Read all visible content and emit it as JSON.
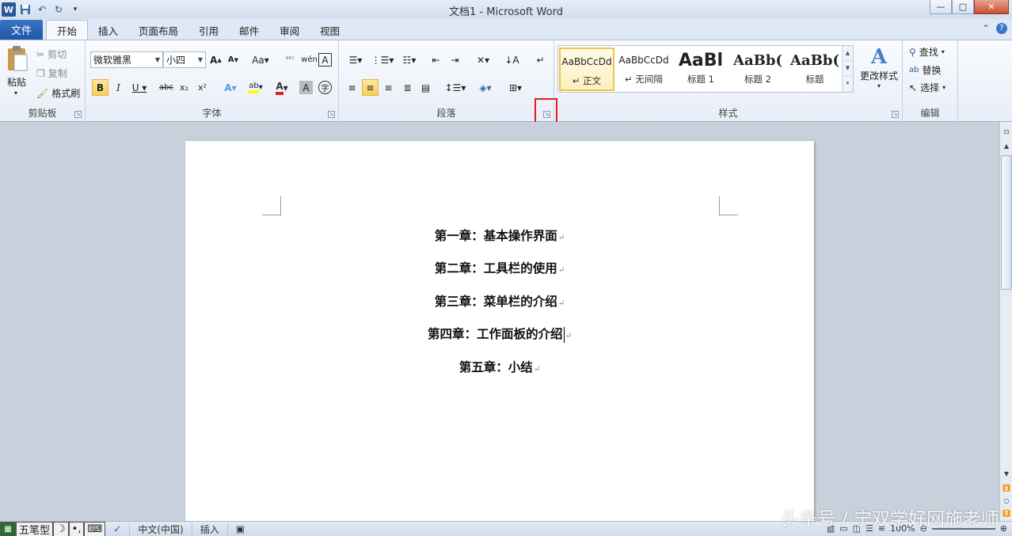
{
  "window": {
    "title": "文档1 - Microsoft Word",
    "minimize": "—",
    "maximize": "□",
    "close": "✕"
  },
  "qat": {
    "word_icon": "W",
    "save_icon": "save-icon",
    "undo_icon": "undo-icon",
    "redo_icon": "redo-icon"
  },
  "tabs": {
    "file": "文件",
    "items": [
      "开始",
      "插入",
      "页面布局",
      "引用",
      "邮件",
      "审阅",
      "视图"
    ]
  },
  "clipboard": {
    "paste": "粘贴",
    "cut": "剪切",
    "copy": "复制",
    "format_painter": "格式刷",
    "label": "剪贴板"
  },
  "font": {
    "family": "微软雅黑",
    "size": "小四",
    "label": "字体"
  },
  "paragraph": {
    "label": "段落"
  },
  "styles": {
    "items": [
      {
        "sample": "AaBbCcDd",
        "name": "↵ 正文"
      },
      {
        "sample": "AaBbCcDd",
        "name": "↵ 无间隔"
      },
      {
        "sample": "AaBl",
        "name": "标题 1"
      },
      {
        "sample": "AaBb(",
        "name": "标题 2"
      },
      {
        "sample": "AaBb(",
        "name": "标题"
      }
    ],
    "change_styles": "更改样式",
    "label": "样式"
  },
  "editing": {
    "find": "查找",
    "replace": "替换",
    "select": "选择",
    "label": "编辑"
  },
  "document": {
    "lines": [
      "第一章：基本操作界面",
      "第二章：工具栏的使用",
      "第三章：菜单栏的介绍",
      "第四章：工作面板的介绍",
      "第五章：小结"
    ],
    "paragraph_mark": "↵"
  },
  "statusbar": {
    "ime": "五笔型",
    "language": "中文(中国)",
    "mode": "插入",
    "zoom": "100%"
  },
  "watermark": "头条号 / 宁双学好网施老师"
}
